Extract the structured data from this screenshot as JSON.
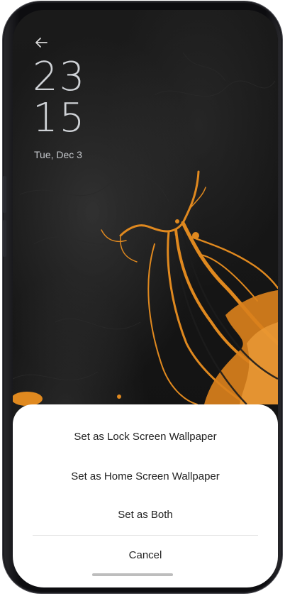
{
  "lock_screen": {
    "time_hours": "23",
    "time_minutes": "15",
    "date": "Tue, Dec 3"
  },
  "wallpaper_sheet": {
    "options": [
      "Set as Lock Screen Wallpaper",
      "Set as Home Screen Wallpaper",
      "Set as Both"
    ],
    "cancel_label": "Cancel"
  },
  "icons": {
    "back": "back-arrow-icon"
  },
  "colors": {
    "accent_orange": "#e0891f",
    "sheet_background": "#ffffff",
    "screen_background": "#131314"
  }
}
